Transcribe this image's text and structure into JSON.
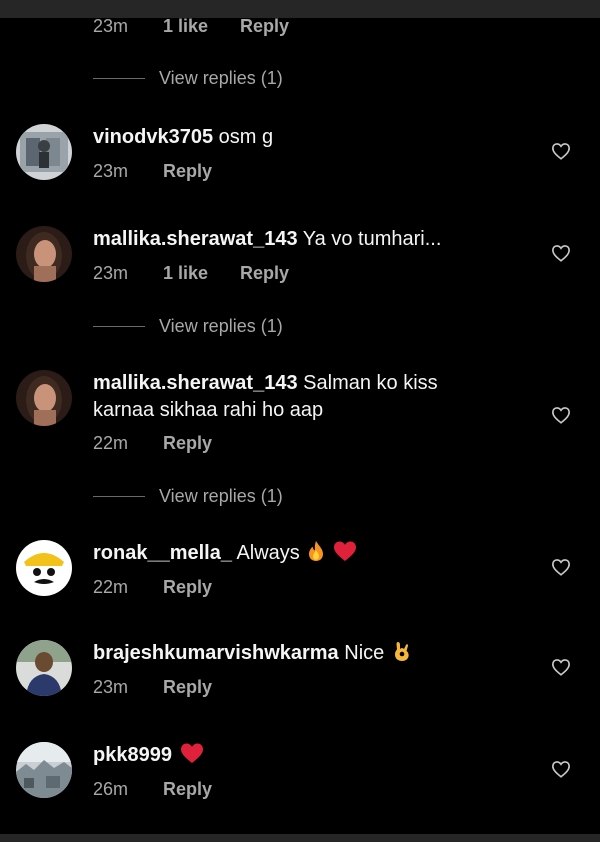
{
  "top_partial": {
    "time": "23m",
    "likes": "1 like",
    "reply": "Reply",
    "view_replies": "View replies (1)"
  },
  "comments": [
    {
      "username": "vinodvk3705",
      "text": "osm g",
      "time": "23m",
      "likes": "",
      "reply": "Reply",
      "view_replies": ""
    },
    {
      "username": "mallika.sherawat_143",
      "text": "Ya vo tumhari...",
      "time": "23m",
      "likes": "1 like",
      "reply": "Reply",
      "view_replies": "View replies (1)"
    },
    {
      "username": "mallika.sherawat_143",
      "text": "Salman ko kiss karnaa sikhaa rahi ho aap",
      "time": "22m",
      "likes": "",
      "reply": "Reply",
      "view_replies": "View replies (1)"
    },
    {
      "username": "ronak__mella_",
      "text": "Always",
      "emojis": [
        "fire-emoji",
        "red-heart-emoji"
      ],
      "time": "22m",
      "likes": "",
      "reply": "Reply",
      "view_replies": ""
    },
    {
      "username": "brajeshkumarvishwkarma",
      "text": "Nice",
      "emojis": [
        "ok-hand-emoji"
      ],
      "time": "23m",
      "likes": "",
      "reply": "Reply",
      "view_replies": ""
    },
    {
      "username": "pkk8999",
      "text": "",
      "emojis": [
        "red-heart-emoji"
      ],
      "time": "26m",
      "likes": "",
      "reply": "Reply",
      "view_replies": ""
    }
  ],
  "icons": {
    "like": "heart-outline-icon"
  },
  "colors": {
    "background": "#000000",
    "primary_text": "#f5f5f5",
    "secondary_text": "#a8a8a8",
    "heart_red": "#e0213a"
  }
}
